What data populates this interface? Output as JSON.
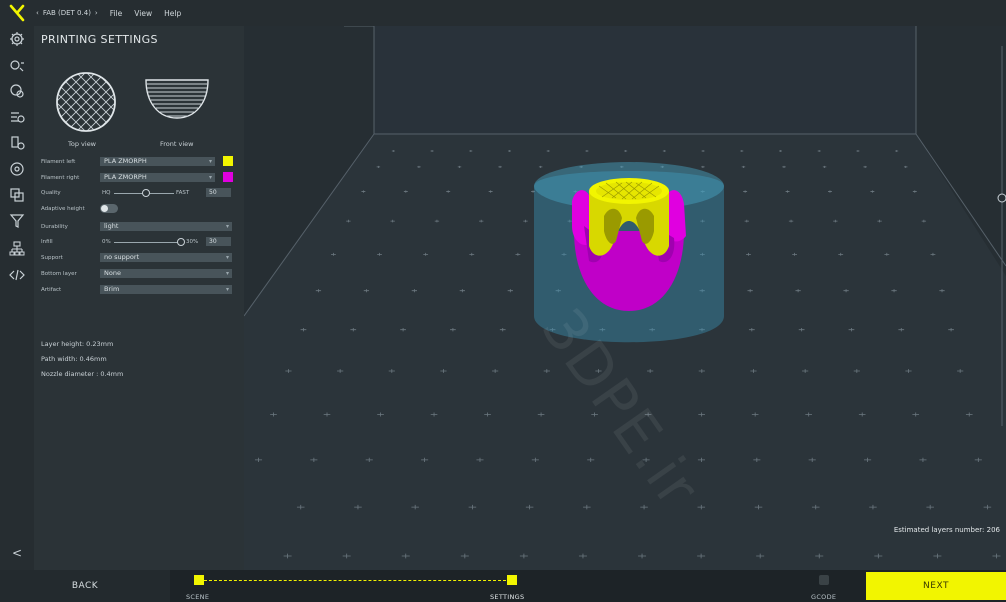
{
  "topbar": {
    "breadcrumb": "FAB (DET 0.4)",
    "menu": [
      "File",
      "View",
      "Help"
    ]
  },
  "rail": {
    "icons": [
      "printing-settings-icon",
      "advanced-settings-icon",
      "material-icon",
      "slicer-settings-icon",
      "extruder-icon",
      "support-icon",
      "layers-icon",
      "filter-icon",
      "network-icon",
      "code-icon"
    ],
    "collapse_glyph": "<"
  },
  "panel": {
    "title": "PRINTING SETTINGS",
    "top_view_label": "Top view",
    "front_view_label": "Front view",
    "rows": {
      "filament_left": {
        "label": "Filament left",
        "value": "PLA ZMORPH",
        "color": "#f2f500"
      },
      "filament_right": {
        "label": "Filament right",
        "value": "PLA ZMORPH",
        "color": "#e000e0"
      },
      "quality": {
        "label": "Quality",
        "min": "HQ",
        "max": "FAST",
        "value": "50"
      },
      "adaptive_height": {
        "label": "Adaptive height"
      },
      "durability": {
        "label": "Durability",
        "value": "light"
      },
      "infill": {
        "label": "Infill",
        "min": "0%",
        "max": "30%",
        "value": "30"
      },
      "support": {
        "label": "Support",
        "value": "no support"
      },
      "bottom_layer": {
        "label": "Bottom layer",
        "value": "None"
      },
      "artifact": {
        "label": "Artifact",
        "value": "Brim"
      }
    },
    "info": {
      "layer_height": "Layer height: 0.23mm",
      "path_width": "Path width: 0.46mm",
      "nozzle_diameter": "Nozzle diameter : 0.4mm"
    }
  },
  "viewport": {
    "estimated_layers": "Estimated layers number: 206",
    "watermark": "3DPE.ir"
  },
  "bottombar": {
    "back_label": "BACK",
    "next_label": "NEXT",
    "steps": [
      "SCENE",
      "SETTINGS",
      "GCODE"
    ]
  },
  "colors": {
    "accent": "#f2f500",
    "magenta": "#e000e0",
    "panel": "#2b3337",
    "viewport": "#262e33"
  }
}
